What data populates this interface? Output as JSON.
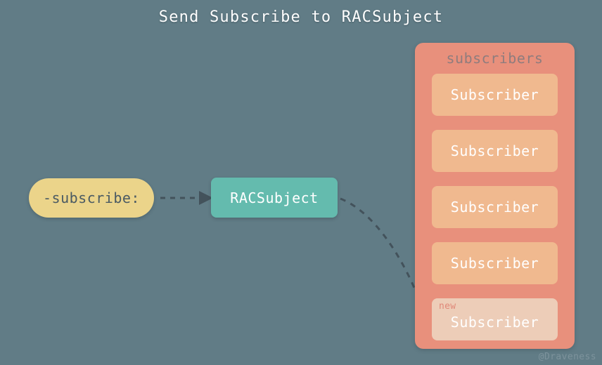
{
  "title": "Send Subscribe to RACSubject",
  "nodes": {
    "subscribe": {
      "label": "-subscribe:"
    },
    "racsubject": {
      "label": "RACSubject"
    }
  },
  "panel": {
    "title": "subscribers",
    "items": [
      {
        "label": "Subscriber",
        "tag": ""
      },
      {
        "label": "Subscriber",
        "tag": ""
      },
      {
        "label": "Subscriber",
        "tag": ""
      },
      {
        "label": "Subscriber",
        "tag": ""
      },
      {
        "label": "Subscriber",
        "tag": "new"
      }
    ]
  },
  "watermark": "@Draveness",
  "colors": {
    "background": "#617c86",
    "pill": "#ebd48a",
    "pill_text": "#4a5a63",
    "teal": "#64bbae",
    "panel": "#e8907c",
    "panel_title_text": "#8f7c7d",
    "subscriber_box": "#f0b98f",
    "subscriber_box_new": "#edcdb8",
    "new_tag_text": "#e08878",
    "connector": "#43525b",
    "title_text": "#ffffff",
    "watermark_text": "#7d939c"
  }
}
